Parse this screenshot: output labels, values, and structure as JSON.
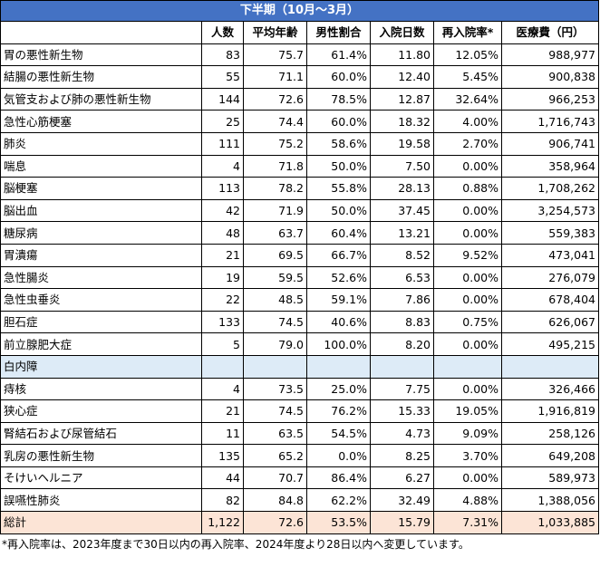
{
  "title": "下半期（10月～3月）",
  "headers": [
    "",
    "人数",
    "平均年齢",
    "男性割合",
    "入院日数",
    "再入院率*",
    "医療費（円）"
  ],
  "rows": [
    {
      "name": "胃の悪性新生物",
      "count": "83",
      "age": "75.7",
      "male": "61.4%",
      "days": "11.80",
      "readmit": "12.05%",
      "cost": "988,977"
    },
    {
      "name": "結腸の悪性新生物",
      "count": "55",
      "age": "71.1",
      "male": "60.0%",
      "days": "12.40",
      "readmit": "5.45%",
      "cost": "900,838"
    },
    {
      "name": "気管支および肺の悪性新生物",
      "count": "144",
      "age": "72.6",
      "male": "78.5%",
      "days": "12.87",
      "readmit": "32.64%",
      "cost": "966,253"
    },
    {
      "name": "急性心筋梗塞",
      "count": "25",
      "age": "74.4",
      "male": "60.0%",
      "days": "18.32",
      "readmit": "4.00%",
      "cost": "1,716,743"
    },
    {
      "name": "肺炎",
      "count": "111",
      "age": "75.2",
      "male": "58.6%",
      "days": "19.58",
      "readmit": "2.70%",
      "cost": "906,741"
    },
    {
      "name": "喘息",
      "count": "4",
      "age": "71.8",
      "male": "50.0%",
      "days": "7.50",
      "readmit": "0.00%",
      "cost": "358,964"
    },
    {
      "name": "脳梗塞",
      "count": "113",
      "age": "78.2",
      "male": "55.8%",
      "days": "28.13",
      "readmit": "0.88%",
      "cost": "1,708,262"
    },
    {
      "name": "脳出血",
      "count": "42",
      "age": "71.9",
      "male": "50.0%",
      "days": "37.45",
      "readmit": "0.00%",
      "cost": "3,254,573"
    },
    {
      "name": "糖尿病",
      "count": "48",
      "age": "63.7",
      "male": "60.4%",
      "days": "13.21",
      "readmit": "0.00%",
      "cost": "559,383"
    },
    {
      "name": "胃潰瘍",
      "count": "21",
      "age": "69.5",
      "male": "66.7%",
      "days": "8.52",
      "readmit": "9.52%",
      "cost": "473,041"
    },
    {
      "name": "急性腸炎",
      "count": "19",
      "age": "59.5",
      "male": "52.6%",
      "days": "6.53",
      "readmit": "0.00%",
      "cost": "276,079"
    },
    {
      "name": "急性虫垂炎",
      "count": "22",
      "age": "48.5",
      "male": "59.1%",
      "days": "7.86",
      "readmit": "0.00%",
      "cost": "678,404"
    },
    {
      "name": "胆石症",
      "count": "133",
      "age": "74.5",
      "male": "40.6%",
      "days": "8.83",
      "readmit": "0.75%",
      "cost": "626,067"
    },
    {
      "name": "前立腺肥大症",
      "count": "5",
      "age": "79.0",
      "male": "100.0%",
      "days": "8.20",
      "readmit": "0.00%",
      "cost": "495,215"
    },
    {
      "name": "白内障",
      "count": "",
      "age": "",
      "male": "",
      "days": "",
      "readmit": "",
      "cost": "",
      "highlight": true
    },
    {
      "name": "痔核",
      "count": "4",
      "age": "73.5",
      "male": "25.0%",
      "days": "7.75",
      "readmit": "0.00%",
      "cost": "326,466"
    },
    {
      "name": "狭心症",
      "count": "21",
      "age": "74.5",
      "male": "76.2%",
      "days": "15.33",
      "readmit": "19.05%",
      "cost": "1,916,819"
    },
    {
      "name": "腎結石および尿管結石",
      "count": "11",
      "age": "63.5",
      "male": "54.5%",
      "days": "4.73",
      "readmit": "9.09%",
      "cost": "258,126"
    },
    {
      "name": "乳房の悪性新生物",
      "count": "135",
      "age": "65.2",
      "male": "0.0%",
      "days": "8.25",
      "readmit": "3.70%",
      "cost": "649,208"
    },
    {
      "name": "そけいヘルニア",
      "count": "44",
      "age": "70.7",
      "male": "86.4%",
      "days": "6.27",
      "readmit": "0.00%",
      "cost": "589,973"
    },
    {
      "name": "誤嚥性肺炎",
      "count": "82",
      "age": "84.8",
      "male": "62.2%",
      "days": "32.49",
      "readmit": "4.88%",
      "cost": "1,388,056"
    }
  ],
  "total": {
    "name": "総計",
    "count": "1,122",
    "age": "72.6",
    "male": "53.5%",
    "days": "15.79",
    "readmit": "7.31%",
    "cost": "1,033,885"
  },
  "footnote": "*再入院率は、2023年度まで30日以内の再入院率、2024年度より28日以内へ変更しています。"
}
